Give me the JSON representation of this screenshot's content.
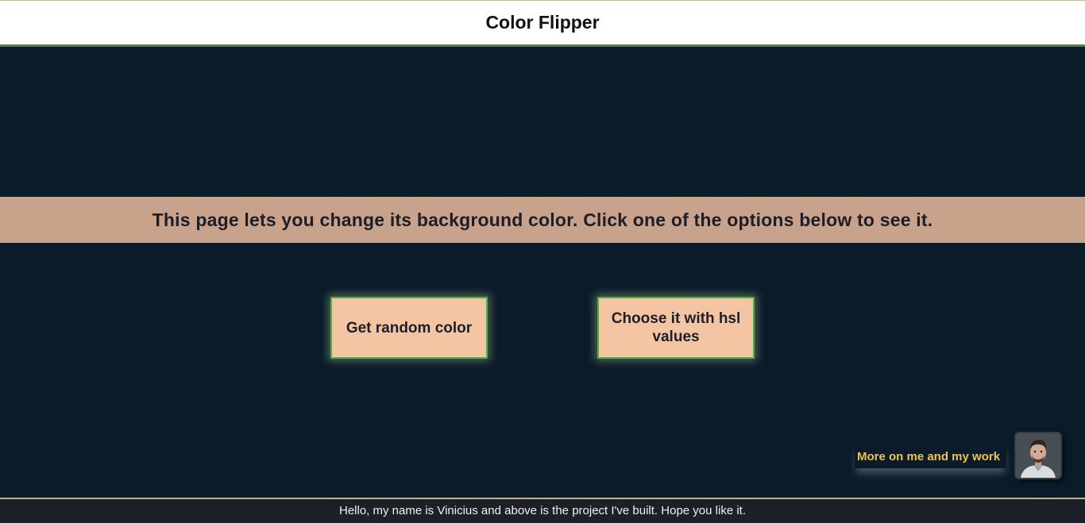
{
  "header": {
    "title": "Color Flipper"
  },
  "banner": {
    "text": "This page lets you change its background color. Click one of the options below to see it."
  },
  "buttons": {
    "random_label": "Get random color",
    "hsl_label": "Choose it with hsl values"
  },
  "profile": {
    "link_label": "More on me and my work",
    "avatar_icon": "person-avatar-icon"
  },
  "footer": {
    "text": "Hello, my name is Vinicius and above is the project I've built. Hope you like it."
  },
  "colors": {
    "background": "#0a1c2a",
    "banner": "#c8a28a",
    "button": "#f4c5a2",
    "button_border": "#3fb54a",
    "link": "#f0c443"
  }
}
